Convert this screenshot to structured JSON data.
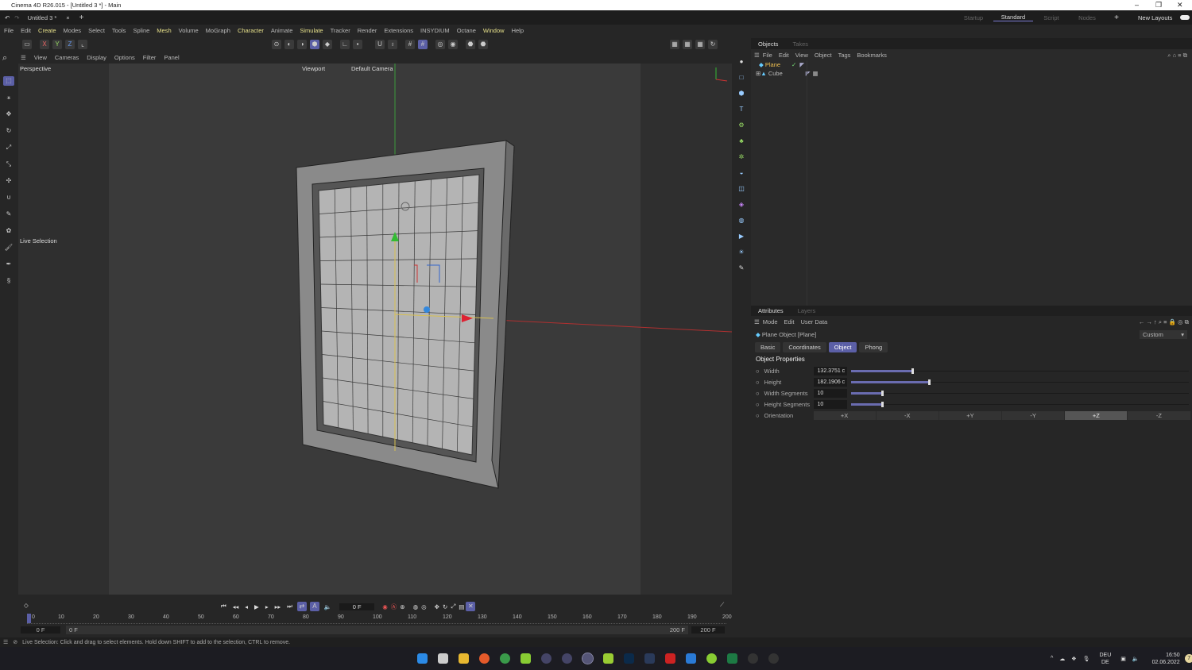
{
  "window": {
    "title": "Cinema 4D R26.015 - [Untitled 3 *] - Main",
    "minimize": "–",
    "maximize": "❐",
    "close": "✕"
  },
  "tabs": {
    "doc_tab": "Untitled 3 *",
    "close": "×",
    "add": "+",
    "layouts": [
      "Startup",
      "Standard",
      "Script",
      "Nodes"
    ],
    "active_layout": "Standard",
    "add_layout": "+",
    "new_layouts": "New Layouts"
  },
  "menu": [
    "File",
    "Edit",
    "Create",
    "Modes",
    "Select",
    "Tools",
    "Spline",
    "Mesh",
    "Volume",
    "MoGraph",
    "Character",
    "Animate",
    "Simulate",
    "Tracker",
    "Render",
    "Extensions",
    "INSYDIUM",
    "Octane",
    "Window",
    "Help"
  ],
  "highlighted_menus": [
    "Create",
    "Mesh",
    "Character",
    "Simulate",
    "Window"
  ],
  "toolbar": {
    "axes": [
      "X",
      "Y",
      "Z"
    ]
  },
  "viewport": {
    "menu": [
      "View",
      "Cameras",
      "Display",
      "Options",
      "Filter",
      "Panel"
    ],
    "view_name": "Perspective",
    "viewport_label": "Viewport",
    "camera_label": "Default Camera",
    "tool_label": "Live Selection"
  },
  "objects_panel": {
    "tabs": [
      "Objects",
      "Takes"
    ],
    "menu": [
      "File",
      "Edit",
      "View",
      "Object",
      "Tags",
      "Bookmarks"
    ],
    "items": [
      {
        "name": "Plane",
        "selected": true
      },
      {
        "name": "Cube",
        "selected": false
      }
    ]
  },
  "attributes_panel": {
    "tabs": [
      "Attributes",
      "Layers"
    ],
    "menu": [
      "Mode",
      "Edit",
      "User Data"
    ],
    "object_title": "Plane Object [Plane]",
    "preset": "Custom",
    "subtabs": [
      "Basic",
      "Coordinates",
      "Object",
      "Phong"
    ],
    "active_subtab": "Object",
    "section": "Object Properties",
    "properties": [
      {
        "label": "Width",
        "value": "132.3751 c",
        "slider": 0.18
      },
      {
        "label": "Height",
        "value": "182.1906 c",
        "slider": 0.23
      },
      {
        "label": "Width Segments",
        "value": "10",
        "slider": 0.09
      },
      {
        "label": "Height Segments",
        "value": "10",
        "slider": 0.09
      }
    ],
    "orientation": {
      "label": "Orientation",
      "options": [
        "+X",
        "-X",
        "+Y",
        "-Y",
        "+Z",
        "-Z"
      ],
      "selected": "+Z"
    }
  },
  "timeline": {
    "current_frame": "0 F",
    "ticks": [
      "0",
      "10",
      "20",
      "30",
      "40",
      "50",
      "60",
      "70",
      "80",
      "90",
      "100",
      "110",
      "120",
      "130",
      "140",
      "150",
      "160",
      "170",
      "180",
      "190",
      "200"
    ],
    "start": "0 F",
    "range_start": "0 F",
    "range_end": "200 F",
    "end": "200 F"
  },
  "status": "Live Selection: Click and drag to select elements. Hold down SHIFT to add to the selection, CTRL to remove.",
  "taskbar": {
    "lang1": "DEU",
    "lang2": "DE",
    "time": "16:50",
    "date": "02.06.2022",
    "badge": "7"
  },
  "colors": {
    "accent": "#5b5fa6",
    "highlight_menu": "#e6e08a",
    "selected_object": "#f0c050"
  }
}
